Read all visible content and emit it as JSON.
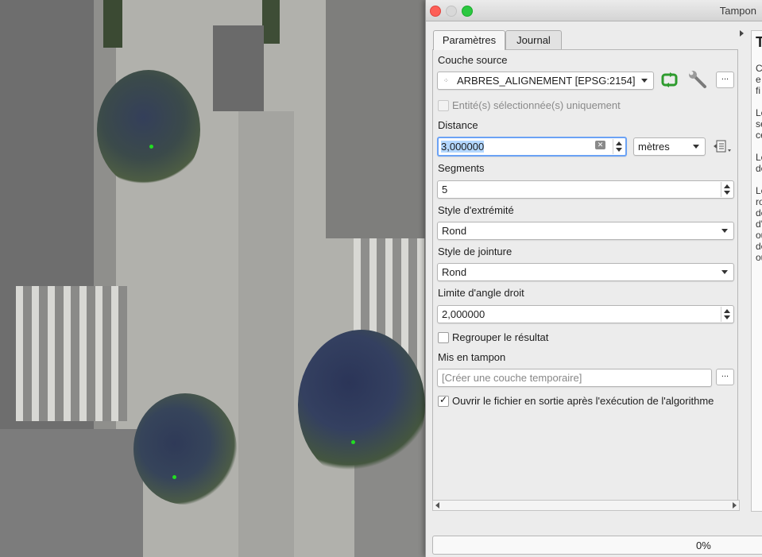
{
  "window": {
    "title": "Tampon"
  },
  "tabs": [
    {
      "label": "Paramètres",
      "active": true
    },
    {
      "label": "Journal",
      "active": false
    }
  ],
  "params": {
    "source_label": "Couche source",
    "source_value": "ARBRES_ALIGNEMENT [EPSG:2154]",
    "selected_only_label": "Entité(s) sélectionnée(s) uniquement",
    "distance_label": "Distance",
    "distance_value": "3,000000",
    "distance_unit": "mètres",
    "segments_label": "Segments",
    "segments_value": "5",
    "end_cap_label": "Style d'extrémité",
    "end_cap_value": "Rond",
    "join_label": "Style de jointure",
    "join_value": "Rond",
    "miter_label": "Limite d'angle droit",
    "miter_value": "2,000000",
    "dissolve_label": "Regrouper le résultat",
    "output_label": "Mis en tampon",
    "output_placeholder": "[Créer une couche temporaire]",
    "open_output_label": "Ouvrir le fichier en sortie après l'exécution de l'algorithme",
    "more_button": "..."
  },
  "help": {
    "heading": "T",
    "letters": [
      "C",
      "e",
      "fi",
      "",
      "Le",
      "se",
      "ce",
      "",
      "Le",
      "de",
      "",
      "Le",
      "ro",
      "de",
      "d'",
      "ou",
      "de",
      "ou"
    ]
  },
  "progress": {
    "text": "0%",
    "value": 0
  },
  "colors": {
    "accent": "#3b82f6",
    "selection": "#b3d7ff",
    "refresh_icon": "#2e9b2e"
  }
}
